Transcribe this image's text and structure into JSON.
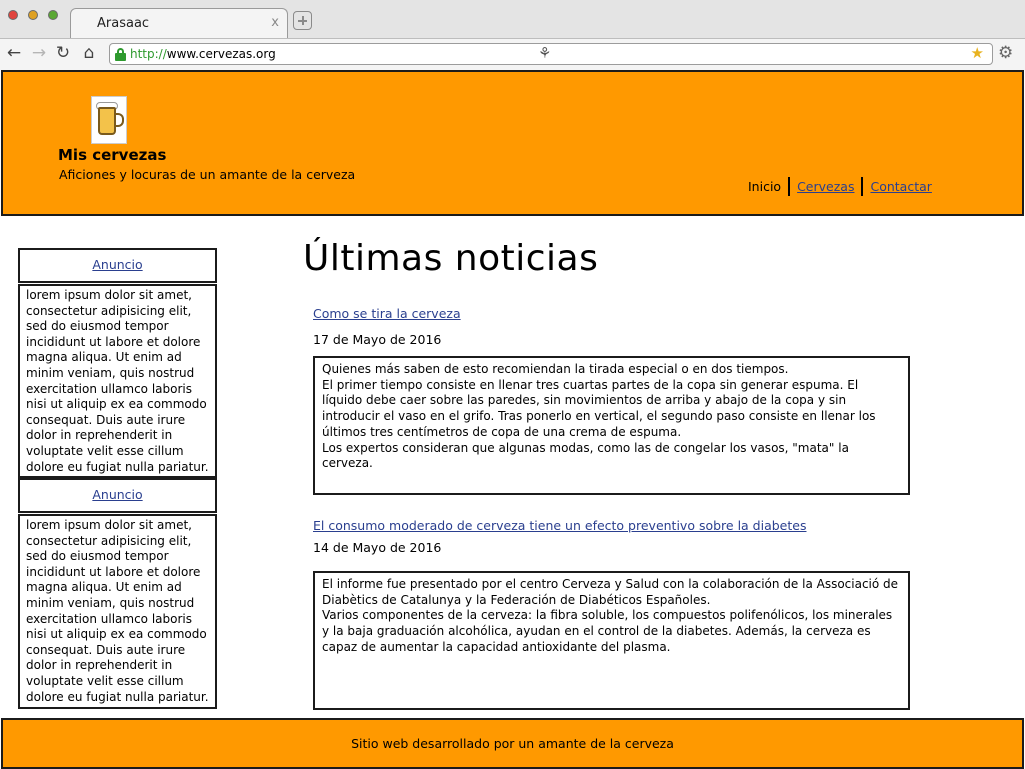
{
  "browser": {
    "tab_title": "Arasaac",
    "tab_close": "x",
    "url_protocol": "http://",
    "url_rest": "www.cervezas.org"
  },
  "header": {
    "site_title": "Mis cervezas",
    "tagline": "Aficiones y locuras de un amante de la cerveza",
    "menu": {
      "home": "Inicio",
      "beers": "Cervezas",
      "contact": "Contactar"
    }
  },
  "sidebar": {
    "ads": [
      {
        "label": "Anuncio",
        "text": "lorem ipsum dolor sit amet, consectetur adipisicing elit, sed do eiusmod tempor incididunt ut labore et dolore magna aliqua. Ut enim ad minim veniam, quis nostrud exercitation ullamco laboris nisi ut aliquip ex ea commodo consequat. Duis aute irure dolor in reprehenderit in voluptate velit esse cillum dolore eu fugiat nulla pariatur."
      },
      {
        "label": "Anuncio",
        "text": "lorem ipsum dolor sit amet, consectetur adipisicing elit, sed do eiusmod tempor incididunt ut labore et dolore magna aliqua. Ut enim ad minim veniam, quis nostrud exercitation ullamco laboris nisi ut aliquip ex ea commodo consequat. Duis aute irure dolor in reprehenderit in voluptate velit esse cillum dolore eu fugiat nulla pariatur."
      }
    ]
  },
  "main": {
    "title": "Últimas noticias",
    "news": [
      {
        "title": "Como se tira la cerveza",
        "date": "17 de Mayo de 2016",
        "paragraphs": [
          "Quienes más saben de esto recomiendan la tirada especial o en dos tiempos.",
          "El primer tiempo consiste en llenar tres cuartas partes de la copa sin generar espuma. El líquido debe caer sobre las paredes, sin movimientos de arriba y abajo de la copa y sin introducir el vaso en el grifo. Tras ponerlo en vertical, el segundo paso consiste en llenar los últimos tres centímetros de copa de una crema de espuma.",
          "Los expertos consideran que algunas modas, como las de congelar los vasos, \"mata\" la cerveza."
        ]
      },
      {
        "title": "El consumo moderado de cerveza tiene un efecto preventivo sobre la diabetes",
        "date": "14 de Mayo de 2016",
        "paragraphs": [
          "El informe fue presentado por el centro Cerveza y Salud con la colaboración de la Associació de Diabètics de Catalunya y la Federación de Diabéticos Españoles.",
          "Varios componentes de la cerveza: la fibra soluble, los compuestos polifenólicos, los minerales y la baja graduación alcohólica, ayudan en el control de la diabetes. Además, la cerveza es capaz de aumentar la capacidad antioxidante del plasma."
        ]
      }
    ]
  },
  "footer": {
    "text": "Sitio web desarrollado por un amante de la cerveza"
  },
  "colors": {
    "brand_orange": "#ff9900",
    "link_blue": "#2a3f8f"
  }
}
